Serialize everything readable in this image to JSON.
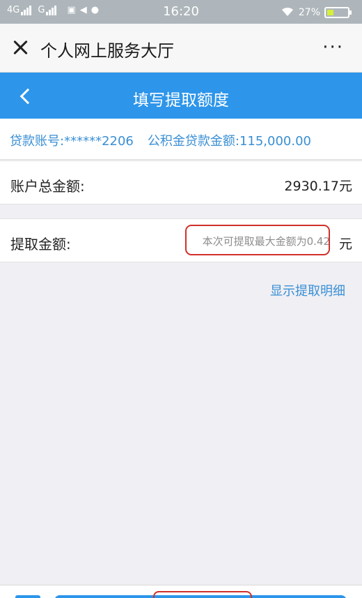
{
  "status_bar": {
    "network_1": "4G",
    "network_2": "G",
    "time": "16:20",
    "battery": "27%",
    "battery_level": 0.27
  },
  "wechat_bar": {
    "title": "个人网上服务大厅",
    "more": "···"
  },
  "app_bar": {
    "title": "填写提取额度"
  },
  "info": {
    "loan_account": "贷款账号:******2206",
    "loan_amount": "公积金贷款金额:115,000.00"
  },
  "account": {
    "label": "账户总金额:",
    "value": "2930.17元"
  },
  "withdraw": {
    "label": "提取金额:",
    "placeholder": "本次可提取最大金额为0.42",
    "unit": "元"
  },
  "detail_link": "显示提取明细",
  "colors": {
    "accent": "#2d95ea",
    "link": "#3a8fd4",
    "highlight": "#d0302c"
  }
}
